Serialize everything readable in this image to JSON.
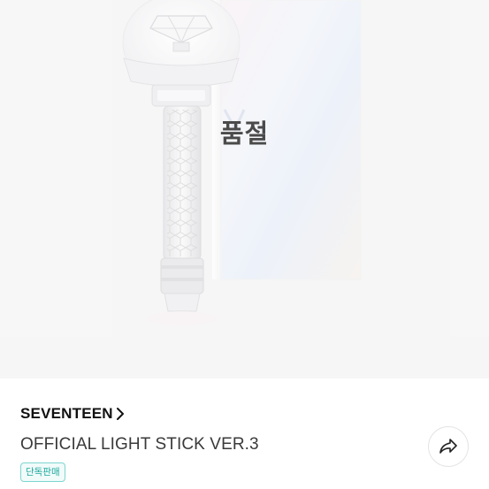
{
  "product": {
    "soldout_label": "품절",
    "image_description_icon": "lightstick-image",
    "artist": "SEVENTEEN",
    "title": "OFFICIAL LIGHT STICK VER.3",
    "badge": "단독판매"
  },
  "actions": {
    "share_icon": "share-icon",
    "artist_chevron_icon": "chevron-right-icon"
  },
  "colors": {
    "image_background": "#f2f2f2",
    "badge_border": "#7fd6cf",
    "badge_text": "#1fa89e",
    "artist_text": "#111111",
    "title_text": "#3a3a3a"
  }
}
